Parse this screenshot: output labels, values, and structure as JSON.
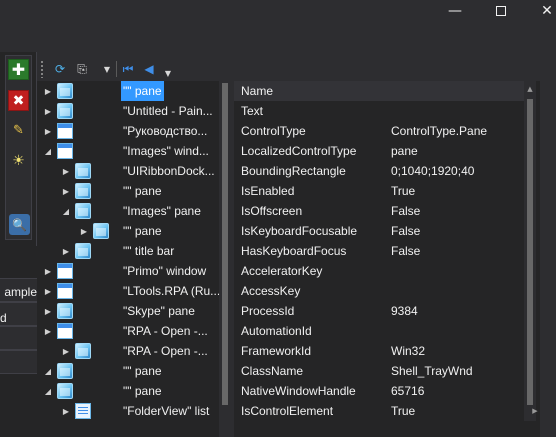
{
  "window": {
    "minimize_glyph": "—",
    "close_glyph": "✕"
  },
  "left_toolbar": {
    "add_glyph": "✚",
    "delete_glyph": "✖",
    "pick_glyph": "✎",
    "highlight_glyph": "☀",
    "inspect_glyph": "🔍"
  },
  "left_panel": {
    "rows": [
      "ample",
      "d"
    ]
  },
  "toolbar": {
    "refresh_glyph": "⟳",
    "copy_glyph": "⎘",
    "dropdown_glyph": "▼",
    "first_glyph": "⏮",
    "back_glyph": "◀"
  },
  "tree": {
    "nodes": [
      {
        "label": "\"\" pane",
        "icon": "pane-icon",
        "expander": "▶",
        "selected": true
      },
      {
        "label": "\"Untitled - Pain...",
        "icon": "pane-icon",
        "expander": "▶",
        "selected": false
      },
      {
        "label": "\"Руководство...",
        "icon": "window-icon",
        "expander": "▶",
        "selected": false
      },
      {
        "label": "\"Images\" wind...",
        "icon": "window-icon",
        "expander": "◢",
        "selected": false
      },
      {
        "label": "\"UIRibbonDock...",
        "icon": "pane-icon",
        "expander": "▶",
        "selected": false
      },
      {
        "label": "\"\" pane",
        "icon": "pane-icon",
        "expander": "▶",
        "selected": false
      },
      {
        "label": "\"Images\" pane",
        "icon": "pane-icon",
        "expander": "◢",
        "selected": false
      },
      {
        "label": "\"\" pane",
        "icon": "pane-icon",
        "expander": "▶",
        "selected": false
      },
      {
        "label": "\"\" title bar",
        "icon": "pane-icon",
        "expander": "▶",
        "selected": false
      },
      {
        "label": "\"Primo\" window",
        "icon": "window-icon",
        "expander": "▶",
        "selected": false
      },
      {
        "label": "\"LTools.RPA (Ru...",
        "icon": "window-icon",
        "expander": "▶",
        "selected": false
      },
      {
        "label": "\"Skype\" pane",
        "icon": "pane-icon",
        "expander": "▶",
        "selected": false
      },
      {
        "label": "\"RPA - Open -...",
        "icon": "window-icon",
        "expander": "▶",
        "selected": false
      },
      {
        "label": "\"RPA - Open -...",
        "icon": "pane-icon",
        "expander": "▶",
        "selected": false
      },
      {
        "label": "\"\" pane",
        "icon": "pane-icon",
        "expander": "◢",
        "selected": false
      },
      {
        "label": "\"\" pane",
        "icon": "pane-icon",
        "expander": "◢",
        "selected": false
      },
      {
        "label": "\"FolderView\" list",
        "icon": "list-icon",
        "expander": "▶",
        "selected": false
      }
    ]
  },
  "properties": {
    "rows": [
      {
        "name": "Name",
        "value": ""
      },
      {
        "name": "Text",
        "value": ""
      },
      {
        "name": "ControlType",
        "value": "ControlType.Pane"
      },
      {
        "name": "LocalizedControlType",
        "value": "pane"
      },
      {
        "name": "BoundingRectangle",
        "value": "0;1040;1920;40"
      },
      {
        "name": "IsEnabled",
        "value": "True"
      },
      {
        "name": "IsOffscreen",
        "value": "False"
      },
      {
        "name": "IsKeyboardFocusable",
        "value": "False"
      },
      {
        "name": "HasKeyboardFocus",
        "value": "False"
      },
      {
        "name": "AcceleratorKey",
        "value": ""
      },
      {
        "name": "AccessKey",
        "value": ""
      },
      {
        "name": "ProcessId",
        "value": "9384"
      },
      {
        "name": "AutomationId",
        "value": ""
      },
      {
        "name": "FrameworkId",
        "value": "Win32"
      },
      {
        "name": "ClassName",
        "value": "Shell_TrayWnd"
      },
      {
        "name": "NativeWindowHandle",
        "value": "65716"
      },
      {
        "name": "IsControlElement",
        "value": "True"
      }
    ]
  },
  "scroll": {
    "up_glyph": "▲",
    "down_glyph": "▼",
    "right_glyph": "▶"
  },
  "colors": {
    "background": "#2d2d30",
    "panel": "#252526",
    "selection": "#3399ff",
    "text": "#f1f1f1"
  }
}
